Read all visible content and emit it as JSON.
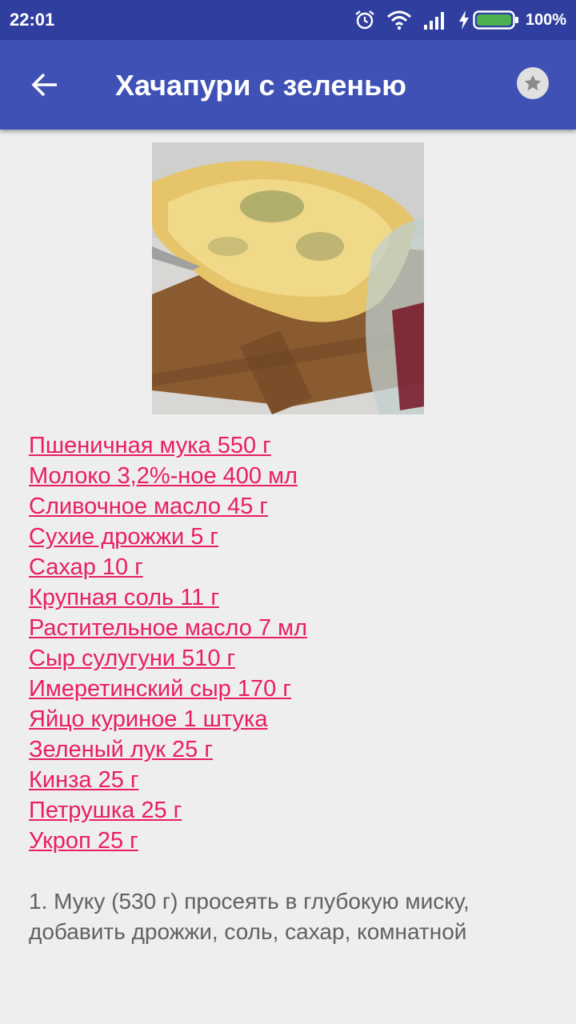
{
  "status_bar": {
    "time": "22:01",
    "battery": "100%"
  },
  "toolbar": {
    "back_icon": "arrow-left-icon",
    "title": "Хачапури с зеленью",
    "favorite_icon": "star-icon"
  },
  "colors": {
    "status_bar": "#303f9f",
    "app_bar": "#3f51b5",
    "link": "#e91e63",
    "body_text": "#616161",
    "background": "#eeeeee"
  },
  "ingredients": [
    "Пшеничная мука 550 г",
    "Молоко 3,2%-ное 400 мл",
    "Сливочное масло 45 г",
    "Сухие дрожжи 5 г",
    "Сахар 10 г",
    "Крупная соль 11 г",
    "Растительное масло 7 мл",
    "Сыр сулугуни 510 г",
    "Имеретинский сыр 170 г",
    "Яйцо куриное 1 штука",
    "Зеленый лук 25 г",
    "Кинза 25 г",
    "Петрушка 25 г",
    "Укроп 25 г"
  ],
  "instructions": "1. Муку (530 г) просеять в глубокую миску, добавить дрожжи, соль, сахар, комнатной"
}
